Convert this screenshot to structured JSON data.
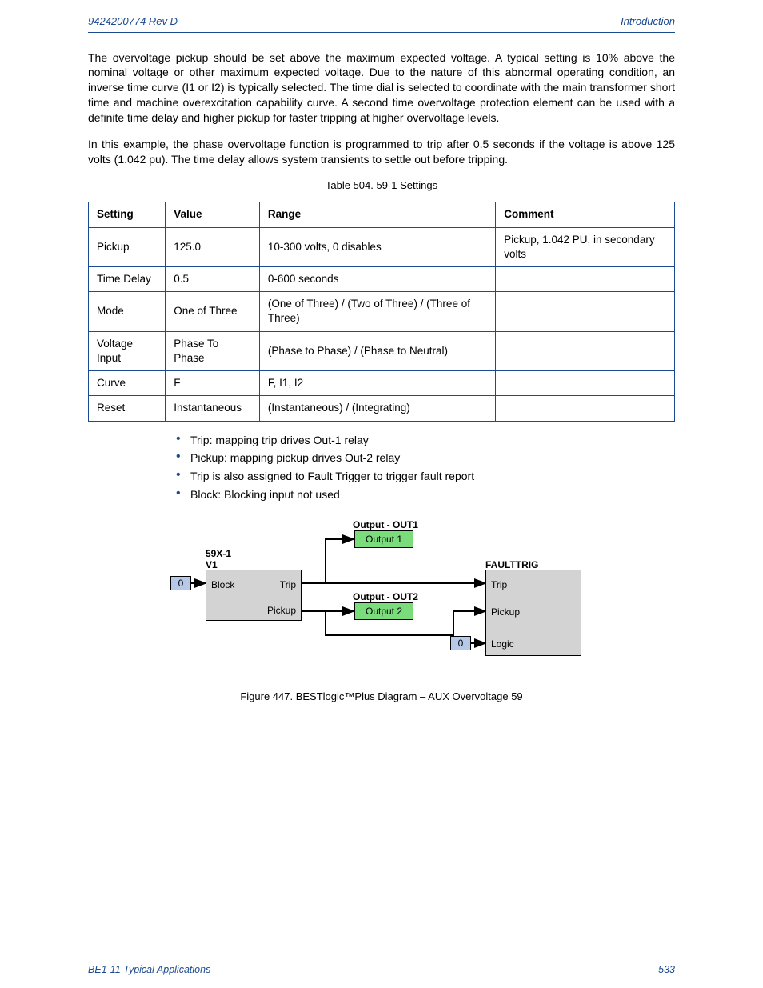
{
  "header": {
    "left": "9424200774 Rev D",
    "right": "Introduction"
  },
  "footer": {
    "left": "BE1-11 Typical Applications",
    "right": "533"
  },
  "paragraph1": "The overvoltage pickup should be set above the maximum expected voltage. A typical setting is 10% above the nominal voltage or other maximum expected voltage. Due to the nature of this abnormal operating condition, an inverse time curve (I1 or I2) is typically selected. The time dial is selected to coordinate with the main transformer short time and machine overexcitation capability curve. A second time overvoltage protection element can be used with a definite time delay and higher pickup for faster tripping at higher overvoltage levels.",
  "paragraph2": "In this example, the phase overvoltage function is programmed to trip after 0.5 seconds if the voltage is above 125 volts (1.042 pu).  The time delay allows system transients to settle out before tripping.",
  "table_caption": "Table 504. 59-1 Settings",
  "table_headers": [
    "Setting",
    "Value",
    "Range",
    "Comment"
  ],
  "table_rows": [
    [
      "Pickup",
      "125.0",
      "10-300 volts, 0 disables",
      "Pickup, 1.042 PU, in secondary volts"
    ],
    [
      "Time Delay",
      "0.5",
      "0-600 seconds",
      ""
    ],
    [
      "Mode",
      "One of Three",
      "(One of Three) / (Two of Three) / (Three of Three)",
      ""
    ],
    [
      "Voltage Input",
      "Phase To Phase",
      "(Phase to Phase) / (Phase to Neutral)",
      ""
    ],
    [
      "Curve",
      "F",
      "F, I1, I2",
      ""
    ],
    [
      "Reset",
      "Instantaneous",
      "(Instantaneous) / (Integrating)",
      ""
    ]
  ],
  "bullets": [
    "Trip:  mapping trip drives Out-1 relay",
    "Pickup: mapping pickup drives Out-2 relay",
    "Trip is also assigned to Fault Trigger to trigger fault report",
    "Block: Blocking input not used"
  ],
  "diagram": {
    "labels": {
      "top_out1": "Output - OUT1",
      "out1_box": "Output 1",
      "top_out2": "Output - OUT2",
      "out2_box": "Output 2",
      "block59x_title1": "59X-1",
      "block59x_title2": "V1",
      "faulttrig_title": "FAULTTRIG",
      "zero1": "0",
      "zero2": "0",
      "block59x_in": "Block",
      "block59x_out1": "Trip",
      "block59x_out2": "Pickup",
      "fault_in1": "Trip",
      "fault_in2": "Pickup",
      "fault_in3": "Logic"
    }
  },
  "figure_caption": "Figure 447.  BESTlogic™Plus Diagram – AUX Overvoltage 59"
}
